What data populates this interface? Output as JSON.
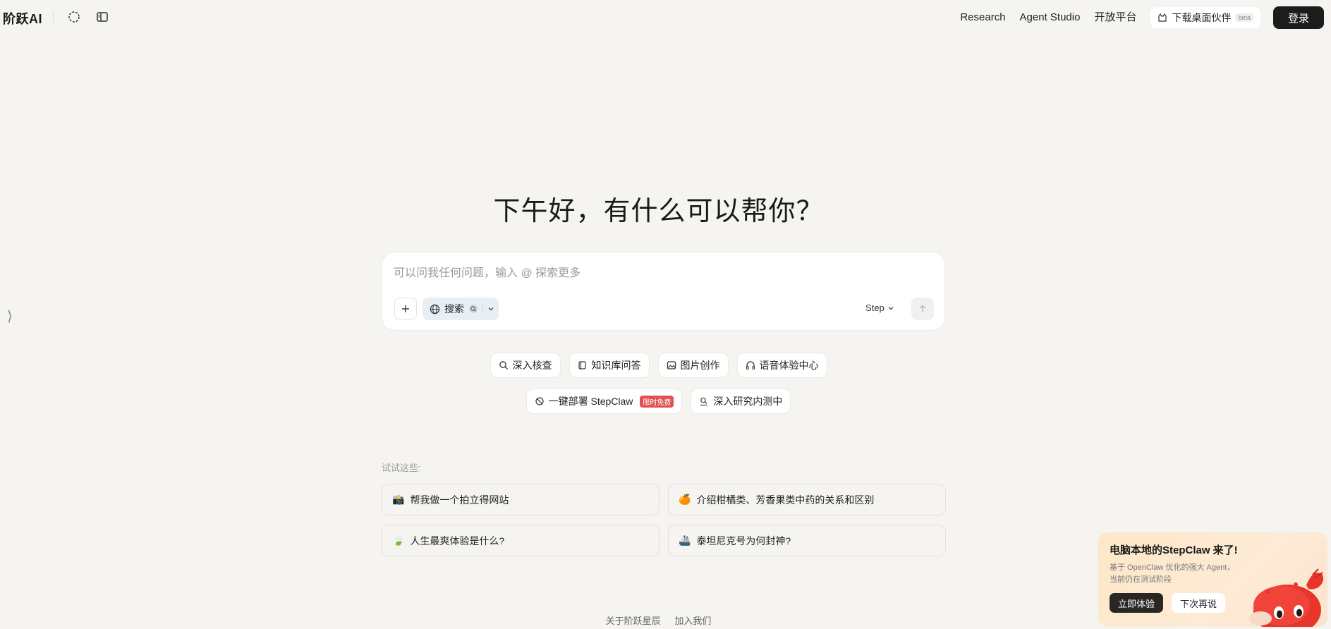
{
  "header": {
    "logo": "阶跃AI",
    "nav": [
      "Research",
      "Agent Studio",
      "开放平台"
    ],
    "download_label": "下载桌面伙伴",
    "beta": "beta",
    "login_label": "登录"
  },
  "main": {
    "greeting": "下午好，有什么可以帮你？",
    "input_placeholder": "可以问我任何问题，输入 @ 探索更多",
    "search_label": "搜索",
    "model_label": "Step",
    "chips_row1": [
      "深入核查",
      "知识库问答",
      "图片创作",
      "语音体验中心"
    ],
    "chips_row2": [
      "一键部署 StepClaw",
      "深入研究内测中"
    ],
    "free_badge": "限时免费",
    "try_label": "试试这些:",
    "suggestions": [
      {
        "icon": "📸",
        "text": "帮我做一个拍立得网站"
      },
      {
        "icon": "🍊",
        "text": "介绍柑橘类、芳香果类中药的关系和区别"
      },
      {
        "icon": "🍃",
        "text": "人生最爽体验是什么?"
      },
      {
        "icon": "🚢",
        "text": "泰坦尼克号为何封神?"
      }
    ]
  },
  "footer": {
    "about": "关于阶跃星辰",
    "join": "加入我们"
  },
  "promo": {
    "title": "电脑本地的StepClaw 来了!",
    "desc_line1": "基于 OpenClaw 优化的强大 Agent，",
    "desc_line2": "当前仍在测试阶段",
    "try_label": "立即体验",
    "later_label": "下次再说"
  }
}
